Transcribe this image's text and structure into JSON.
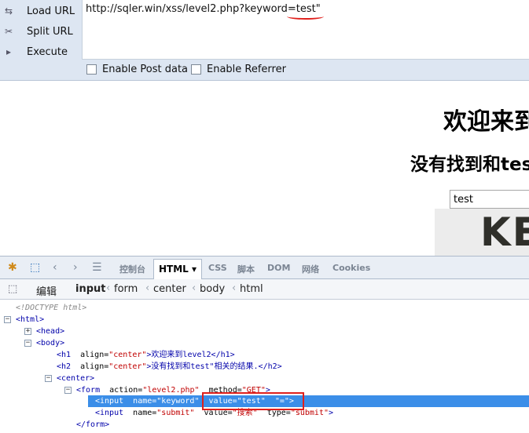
{
  "hackbar": {
    "buttons": [
      {
        "label": "Load URL",
        "icon": "load-url-icon"
      },
      {
        "label": "Split URL",
        "icon": "scissors-icon"
      },
      {
        "label": "Execute",
        "icon": "play-icon"
      }
    ],
    "url": {
      "prefix": "http://sqler.win/xss/level2.php?keyword",
      "highlight": "=test\""
    },
    "options": [
      "Enable Post data",
      "Enable Referrer"
    ]
  },
  "page": {
    "h1": "欢迎来到",
    "h2": "没有找到和tes",
    "input_value": "test",
    "image_text": "KE"
  },
  "firebug": {
    "tabs": [
      "控制台",
      "HTML",
      "CSS",
      "脚本",
      "DOM",
      "网络",
      "Cookies"
    ],
    "active_tab": "HTML",
    "edit_label": "编辑",
    "breadcrumbs": [
      "input",
      "form",
      "center",
      "body",
      "html"
    ],
    "tree": {
      "doctype": "<!DOCTYPE html>",
      "html": "<html>",
      "head": "<head>",
      "body": "<body>",
      "h1": {
        "open": "<h1",
        "attr": "align=",
        "val": "\"center\"",
        "text": ">欢迎来到level2</h1>"
      },
      "h2": {
        "open": "<h2",
        "attr": "align=",
        "val": "\"center\"",
        "text": ">没有找到和test\"相关的结果.</h2>"
      },
      "center": "<center>",
      "form": {
        "open": "<form",
        "a1": "action=",
        "v1": "\"level2.php\"",
        "a2": "method=",
        "v2": "\"GET\"",
        "close": ">"
      },
      "input1": {
        "open": "<input",
        "a1": "name=",
        "v1": "\"keyword\"",
        "a2": "value=",
        "v2": "\"test\"",
        "a3": "\"=\"",
        "close": ">"
      },
      "input2": {
        "open": "<input",
        "a1": "name=",
        "v1": "\"submit\"",
        "a2": "value=",
        "v2": "\"搜索\"",
        "a3": "type=",
        "v3": "\"submit\"",
        "close": ">"
      },
      "form_close": "</form>"
    }
  },
  "colors": {
    "highlight": "#3b8ee8",
    "annotation": "#e0201c"
  }
}
